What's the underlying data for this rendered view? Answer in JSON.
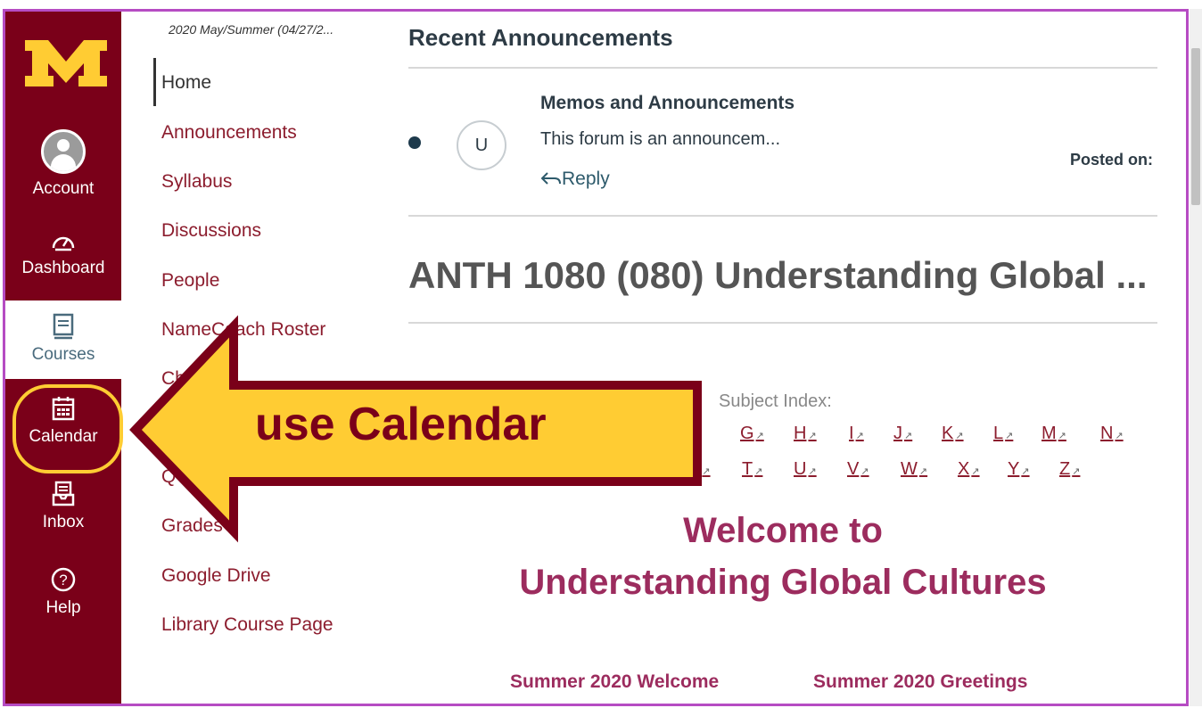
{
  "global_nav": {
    "account": "Account",
    "dashboard": "Dashboard",
    "courses": "Courses",
    "calendar": "Calendar",
    "inbox": "Inbox",
    "help": "Help"
  },
  "course_nav": {
    "term": "2020 May/Summer (04/27/2...",
    "items": [
      "Home",
      "Announcements",
      "Syllabus",
      "Discussions",
      "People",
      "NameCoach Roster",
      "Ch",
      "Q",
      "Grades",
      "Google Drive",
      "Library Course Page"
    ]
  },
  "announcements": {
    "heading": "Recent Announcements",
    "avatar_letter": "U",
    "title": "Memos and Announcements",
    "excerpt": "This forum is an announcem...",
    "reply": "Reply",
    "posted_on": "Posted on:"
  },
  "course_title": "ANTH 1080 (080) Understanding Global ...",
  "subject_index": {
    "label": "Subject Index:",
    "row1": [
      "G",
      "H",
      "I",
      "J",
      "K",
      "L",
      "M",
      "N"
    ],
    "row2": [
      "T",
      "U",
      "V",
      "W",
      "X",
      "Y",
      "Z"
    ],
    "partial": "S"
  },
  "welcome": {
    "line1": "Welcome to",
    "line2": "Understanding Global Cultures"
  },
  "bottom_links": [
    "Summer 2020 Welcome",
    "Summer 2020 Greetings"
  ],
  "overlay": {
    "text": "use Calendar"
  },
  "colors": {
    "maroon": "#7a0019",
    "gold": "#ffcc33",
    "frame": "#b64cc3",
    "welcome": "#9c2c5e"
  }
}
